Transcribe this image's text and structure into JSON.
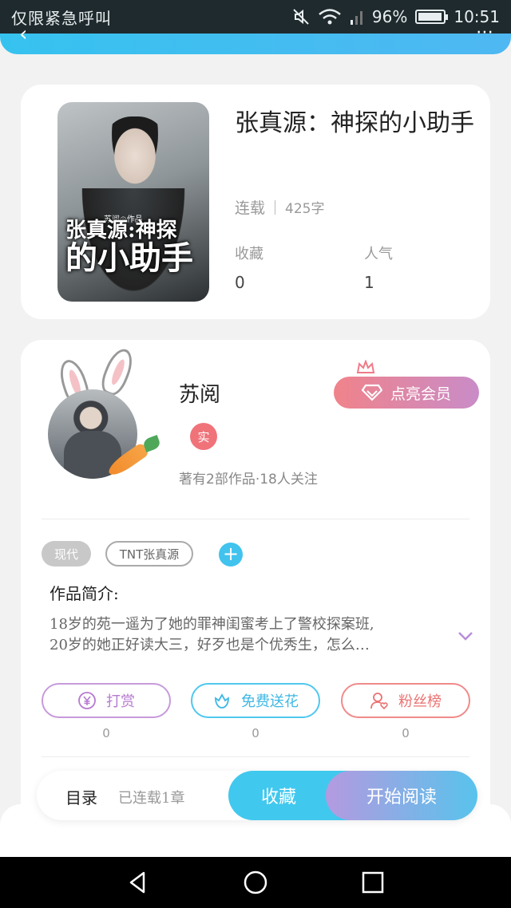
{
  "status_bar": {
    "carrier_text": "仅限紧急呼叫",
    "battery": "96%",
    "battery_level": 0.96,
    "time": "10:51"
  },
  "book": {
    "title": "张真源：神探的小助手",
    "status": "连载",
    "word_count": "425字",
    "collect_label": "收藏",
    "collect_value": "0",
    "popularity_label": "人气",
    "popularity_value": "1",
    "cover": {
      "author_line": "苏阅◎作品",
      "title_line1": "张真源:神探",
      "title_line2": "的小助手"
    }
  },
  "author": {
    "name": "苏阅",
    "verified_badge": "实",
    "stats": "著有2部作品·18人关注",
    "vip_button": "点亮会员"
  },
  "tags": [
    {
      "label": "现代"
    },
    {
      "label": "TNT张真源"
    }
  ],
  "tag_add_label": "+",
  "intro": {
    "title": "作品简介:",
    "line1": "18岁的苑一遥为了她的罪神闺蜜考上了警校探案班,",
    "line2": "20岁的她正好读大三，好歹也是个优秀生，怎么…"
  },
  "actions": {
    "reward_label": "打赏",
    "reward_count": "0",
    "flower_label": "免费送花",
    "flower_count": "0",
    "fans_label": "粉丝榜",
    "fans_count": "0"
  },
  "bottom_bar": {
    "catalog_label": "目录",
    "catalog_status": "已连载1章",
    "collect_button": "收藏",
    "read_button": "开始阅读"
  },
  "colors": {
    "accent_blue": "#41c8ee",
    "vip_pink": "#f0838a",
    "reward_purple": "#c79adb",
    "fans_red": "#f08a8a"
  }
}
